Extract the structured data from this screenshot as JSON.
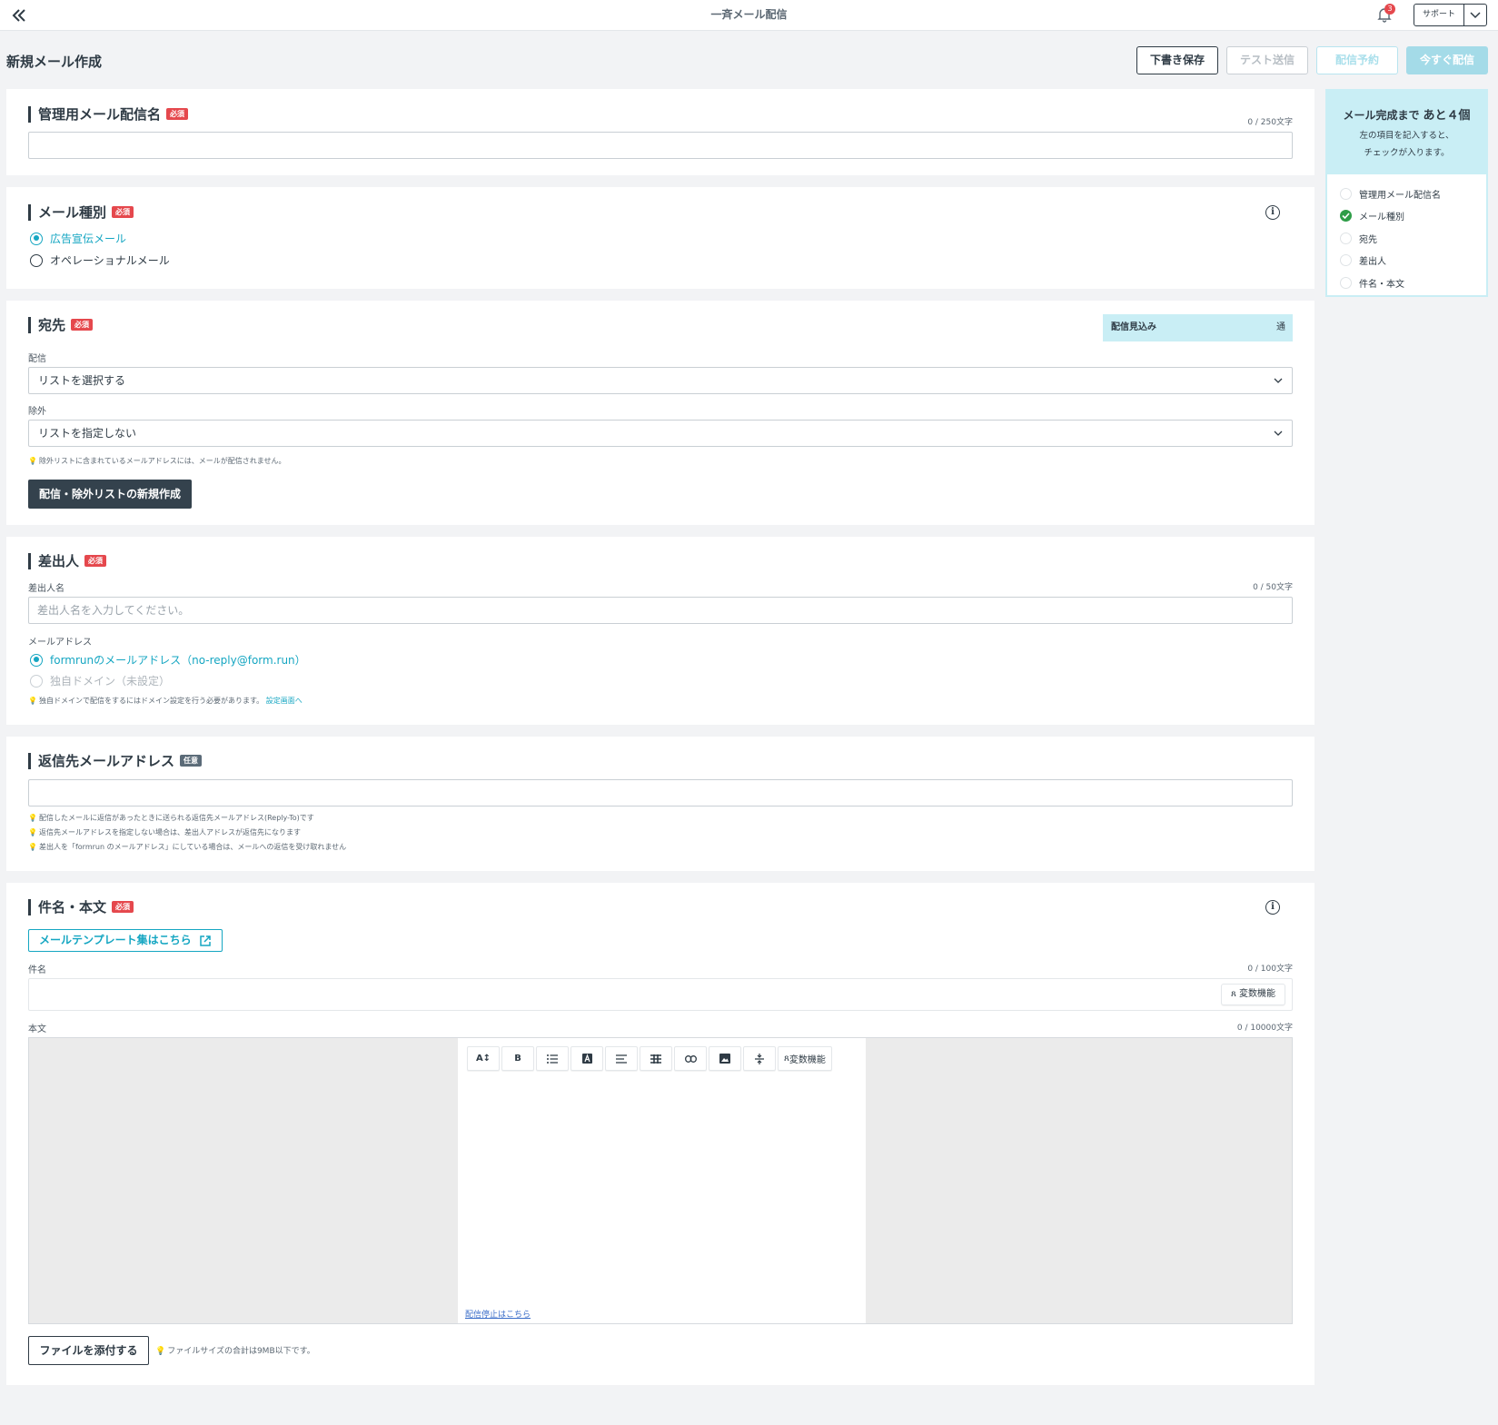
{
  "header": {
    "title": "一斉メール配信",
    "notification_count": "3",
    "support_label": "サポート"
  },
  "page": {
    "title": "新規メール作成",
    "buttons": {
      "draft": "下書き保存",
      "test": "テスト送信",
      "schedule": "配信予約",
      "send_now": "今すぐ配信"
    }
  },
  "badges": {
    "required": "必須",
    "optional": "任意"
  },
  "admin_name": {
    "title": "管理用メール配信名",
    "counter": "0 / 250文字",
    "value": ""
  },
  "mail_type": {
    "title": "メール種別",
    "options": [
      "広告宣伝メール",
      "オペレーショナルメール"
    ],
    "selected": "広告宣伝メール"
  },
  "recipients": {
    "title": "宛先",
    "estimate_label": "配信見込み",
    "estimate_unit": "通",
    "deliver_label": "配信",
    "deliver_value": "リストを選択する",
    "exclude_label": "除外",
    "exclude_value": "リストを指定しない",
    "hint": "除外リストに含まれているメールアドレスには、メールが配信されません。",
    "create_button": "配信・除外リストの新規作成"
  },
  "sender": {
    "title": "差出人",
    "name_label": "差出人名",
    "name_counter": "0 / 50文字",
    "name_placeholder": "差出人名を入力してください。",
    "email_label": "メールアドレス",
    "options": [
      "formrunのメールアドレス（no-reply@form.run）",
      "独自ドメイン（未設定）"
    ],
    "hint": "独自ドメインで配信をするにはドメイン設定を行う必要があります。",
    "hint_link": "設定画面へ"
  },
  "reply_to": {
    "title": "返信先メールアドレス",
    "value": "",
    "hints": [
      "配信したメールに返信があったときに送られる返信先メールアドレス(Reply-To)です",
      "返信先メールアドレスを指定しない場合は、差出人アドレスが返信先になります",
      "差出人を「formrun のメールアドレス」にしている場合は、メールへの返信を受け取れません"
    ]
  },
  "content": {
    "title": "件名・本文",
    "template_button": "メールテンプレート集はこちら",
    "subject_label": "件名",
    "subject_counter": "0 / 100文字",
    "variable_button": "変数機能",
    "body_label": "本文",
    "body_counter": "0 / 10000文字",
    "toolbar": [
      "font-size-icon",
      "bold-icon",
      "bullet-list-icon",
      "text-color-icon",
      "align-icon",
      "table-icon",
      "link-icon",
      "image-icon",
      "divider-icon"
    ],
    "toolbar_bold": "B",
    "toolbar_variable": "変数機能",
    "unsubscribe_link": "配信停止はこちら",
    "attach_button": "ファイルを添付する",
    "attach_hint": "ファイルサイズの合計は9MB以下です。"
  },
  "progress": {
    "title": "メール完成まで",
    "remaining": "あと４個",
    "desc_line1": "左の項目を記入すると、",
    "desc_line2": "チェックが入ります。",
    "items": [
      {
        "label": "管理用メール配信名",
        "done": false
      },
      {
        "label": "メール種別",
        "done": true
      },
      {
        "label": "宛先",
        "done": false
      },
      {
        "label": "差出人",
        "done": false
      },
      {
        "label": "件名・本文",
        "done": false
      }
    ]
  },
  "colors": {
    "accent": "#15a6c2",
    "required_badge": "#e5484d",
    "dark_button": "#34424d",
    "progress_panel": "#c9eef5",
    "check_done": "#2e9d48"
  }
}
